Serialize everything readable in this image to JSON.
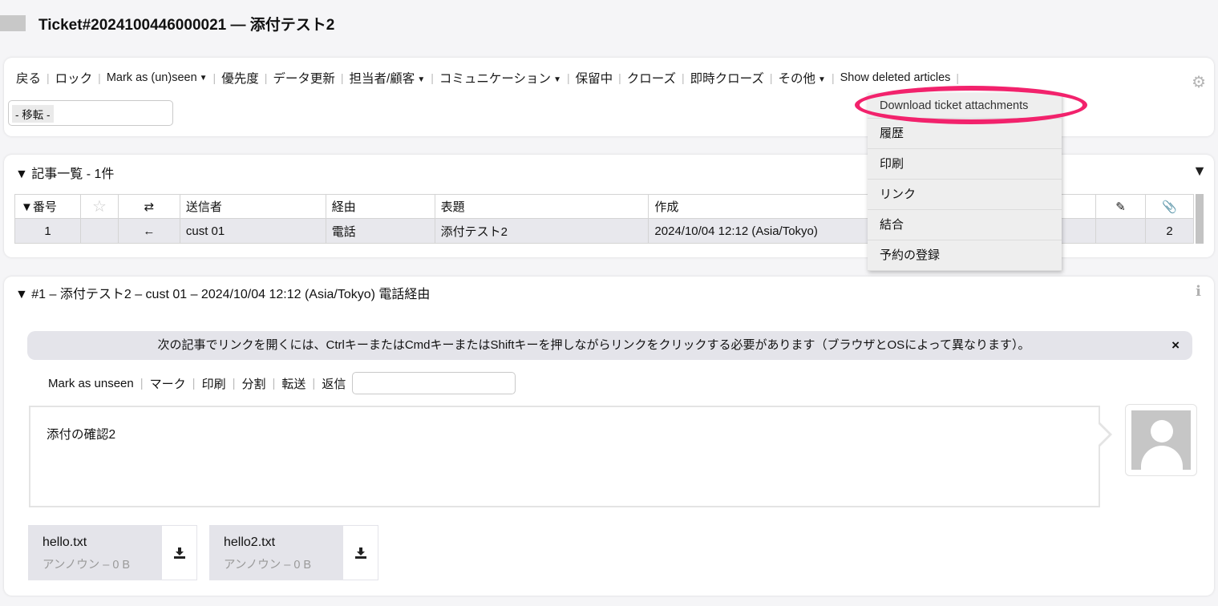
{
  "ticket": {
    "title": "Ticket#2024100446000021 — 添付テスト2"
  },
  "actions": {
    "items": [
      {
        "label": "戻る"
      },
      {
        "label": "ロック"
      },
      {
        "label": "Mark as (un)seen"
      },
      {
        "label": "優先度"
      },
      {
        "label": "データ更新"
      },
      {
        "label": "担当者/顧客"
      },
      {
        "label": "コミュニケーション"
      },
      {
        "label": "保留中"
      },
      {
        "label": "クローズ"
      },
      {
        "label": "即時クローズ"
      },
      {
        "label": "その他"
      },
      {
        "label": "Show deleted articles"
      }
    ],
    "move_placeholder": "- 移転 -"
  },
  "dropdown": {
    "items": [
      {
        "label": "Download ticket attachments"
      },
      {
        "label": "履歴"
      },
      {
        "label": "印刷"
      },
      {
        "label": "リンク"
      },
      {
        "label": "結合"
      },
      {
        "label": "予約の登録"
      }
    ]
  },
  "article_list": {
    "header": "▼ 記事一覧 - 1件",
    "columns": [
      "▼番号",
      "",
      "⇄",
      "送信者",
      "経由",
      "表題",
      "作成",
      "",
      "",
      ""
    ],
    "rows": [
      {
        "no": "1",
        "direction": "←",
        "sender": "cust 01",
        "via": "電話",
        "subject": "添付テスト2",
        "created": "2024/10/04 12:12 (Asia/Tokyo)",
        "attachments": "2"
      }
    ]
  },
  "article": {
    "header": "▼ #1 – 添付テスト2 – cust 01 – 2024/10/04 12:12 (Asia/Tokyo) 電話経由",
    "notice": "次の記事でリンクを開くには、CtrlキーまたはCmdキーまたはShiftキーを押しながらリンクをクリックする必要があります（ブラウザとOSによって異なります）。",
    "notice_close": "×",
    "menu": [
      "Mark as unseen",
      "マーク",
      "印刷",
      "分割",
      "転送",
      "返信"
    ],
    "body": "添付の確認2",
    "attachments": [
      {
        "name": "hello.txt",
        "meta": "アンノウン – 0 B"
      },
      {
        "name": "hello2.txt",
        "meta": "アンノウン – 0 B"
      }
    ]
  },
  "colors": {
    "highlight": "#f2226c",
    "panel_bg": "#ffffff",
    "page_bg": "#f5f5f7"
  }
}
